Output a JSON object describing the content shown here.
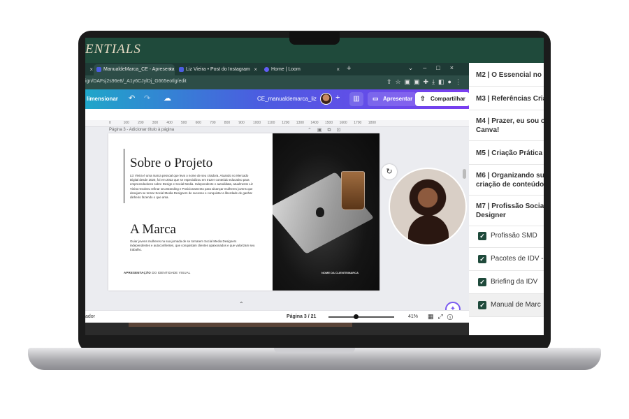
{
  "site": {
    "logo": "ENTIALS"
  },
  "browser": {
    "tabs": [
      {
        "label": "",
        "active": false,
        "favicon_color": "#7a3ef0"
      },
      {
        "label": "ManualdeMarca_CE - Apresenta",
        "active": true,
        "favicon_color": "#4b5de0"
      },
      {
        "label": "Liz Vieira • Post do Instagram",
        "active": false,
        "favicon_color": "#4b5de0"
      },
      {
        "label": "Home | Loom",
        "active": false,
        "favicon_color": "#625df5"
      }
    ],
    "new_tab": "+",
    "url": "ign/DAFsj2s96e8/_A1y6CJylDj_G665eotlg/edit"
  },
  "canva": {
    "resize_label": "limensionar",
    "title": "CE_manualdemarca_liz",
    "present_label": "Apresentar",
    "share_label": "Compartilhar"
  },
  "editor": {
    "ruler_ticks": [
      "0",
      "100",
      "200",
      "300",
      "400",
      "500",
      "600",
      "700",
      "800",
      "900",
      "1000",
      "1100",
      "1200",
      "1300",
      "1400",
      "1500",
      "1600",
      "1700",
      "1800"
    ],
    "page_label": "Página 3 - Adicionar título à página",
    "doc": {
      "heading_1": "Sobre o Projeto",
      "paragraph_1": "Liz Vieira é uma marca pessoal que leva o nome de seu criadora. Atuando no Mercado Digital desde 2020, foi em 2022 que se especializou em trazer conteúdo educativo para empreendedores sobre Design e Social Media. Independente e autodidata, atualmente Liz Vieira resolveu refinar seu Branding e Posicionamento para alcançar mulheres jovens que desejam se tornar Social Media Designers de sucesso e conquistar a liberdade de ganhar dinheiro fazendo o que ama.",
      "heading_2": "A Marca",
      "paragraph_2": "Guiar jovens mulheres na sua jornada de se tornarem Social Media Designers independentes e autoconfientes, que conquistam clientes apaixonados e que valorizam seu trabalho.",
      "footer_bold": "APRESENTAÇÃO",
      "footer_rest": "DO IDENTIDADE VISUAL",
      "photo_caption": "NOME DA CLIENTE/MARCA"
    }
  },
  "status_bar": {
    "left_label": "ador",
    "page_indicator": "Página 3 / 21",
    "zoom_fraction": 0.41,
    "zoom_label": "41%"
  },
  "course": {
    "modules": [
      {
        "label_lines": [
          "M2 | O Essencial no"
        ]
      },
      {
        "label_lines": [
          "M3 | Referências Cria"
        ]
      },
      {
        "label_lines": [
          "M4 | Prazer, eu sou o",
          "Canva!"
        ]
      },
      {
        "label_lines": [
          "M5 | Criação Prática"
        ]
      },
      {
        "label_lines": [
          "M6 | Organizando su",
          "criação de conteúdo"
        ]
      },
      {
        "label_lines": [
          "M7 | Profissão Socia",
          "Designer"
        ]
      }
    ],
    "lessons": [
      {
        "label": "Profissão SMD",
        "completed": true
      },
      {
        "label": "Pacotes de IDV -",
        "completed": true
      },
      {
        "label": "Briefing da IDV",
        "completed": true
      },
      {
        "label": "Manual de Marc",
        "completed": true,
        "active": true
      }
    ]
  },
  "colors": {
    "site_green": "#1f4a3b",
    "canva_gradient_start": "#1fa6c9",
    "canva_gradient_end": "#7a3ef0"
  }
}
